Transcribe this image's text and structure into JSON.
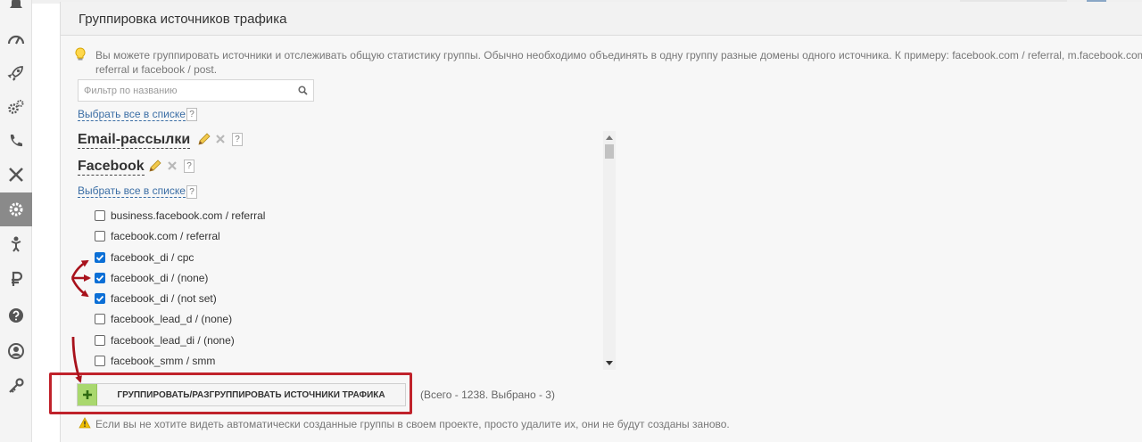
{
  "sidebar": {
    "items": [
      {
        "icon": "bell-icon"
      },
      {
        "icon": "speedometer-icon"
      },
      {
        "icon": "rocket-icon"
      },
      {
        "icon": "gears-icon"
      },
      {
        "icon": "phone-icon"
      },
      {
        "icon": "tools-icon"
      },
      {
        "icon": "gear-icon",
        "active": true
      },
      {
        "icon": "person-icon"
      },
      {
        "icon": "ruble-icon"
      },
      {
        "icon": "help-icon"
      },
      {
        "icon": "user-circle-icon"
      },
      {
        "icon": "key-icon"
      }
    ]
  },
  "panel": {
    "title": "Группировка источников трафика",
    "info_line1": "Вы можете группировать источники и отслеживать общую статистику группы. Обычно необходимо объединять в одну группу разные домены одного источника. К примеру: facebook.com / referral, m.facebook.com / r",
    "info_line2": "referral и facebook / post.",
    "filter_placeholder": "Фильтр по названию",
    "select_all_label": "Выбрать все в списке",
    "help_mark": "?",
    "groups": [
      {
        "name": "Email-рассылки"
      },
      {
        "name": "Facebook"
      }
    ],
    "inner_select_all_label": "Выбрать все в списке",
    "sources": [
      {
        "label": "business.facebook.com / referral",
        "checked": false
      },
      {
        "label": "facebook.com / referral",
        "checked": false
      },
      {
        "label": "facebook_di / cpc",
        "checked": true
      },
      {
        "label": "facebook_di / (none)",
        "checked": true
      },
      {
        "label": "facebook_di / (not set)",
        "checked": true
      },
      {
        "label": "facebook_lead_d / (none)",
        "checked": false
      },
      {
        "label": "facebook_lead_di / (none)",
        "checked": false
      },
      {
        "label": "facebook_smm / smm",
        "checked": false
      }
    ],
    "group_button_label": "ГРУППИРОВАТЬ/РАЗГРУППИРОВАТЬ ИСТОЧНИКИ ТРАФИКА",
    "counts": "(Всего - 1238. Выбрано - 3)",
    "warning": "Если вы не хотите видеть автоматически созданные группы в своем проекте, просто удалите их, они не будут созданы заново."
  },
  "colors": {
    "accent_link": "#3b6ea5",
    "checkbox_checked": "#0b6fd6",
    "annotation": "#c0222b",
    "button_plus": "#a9d86e"
  }
}
